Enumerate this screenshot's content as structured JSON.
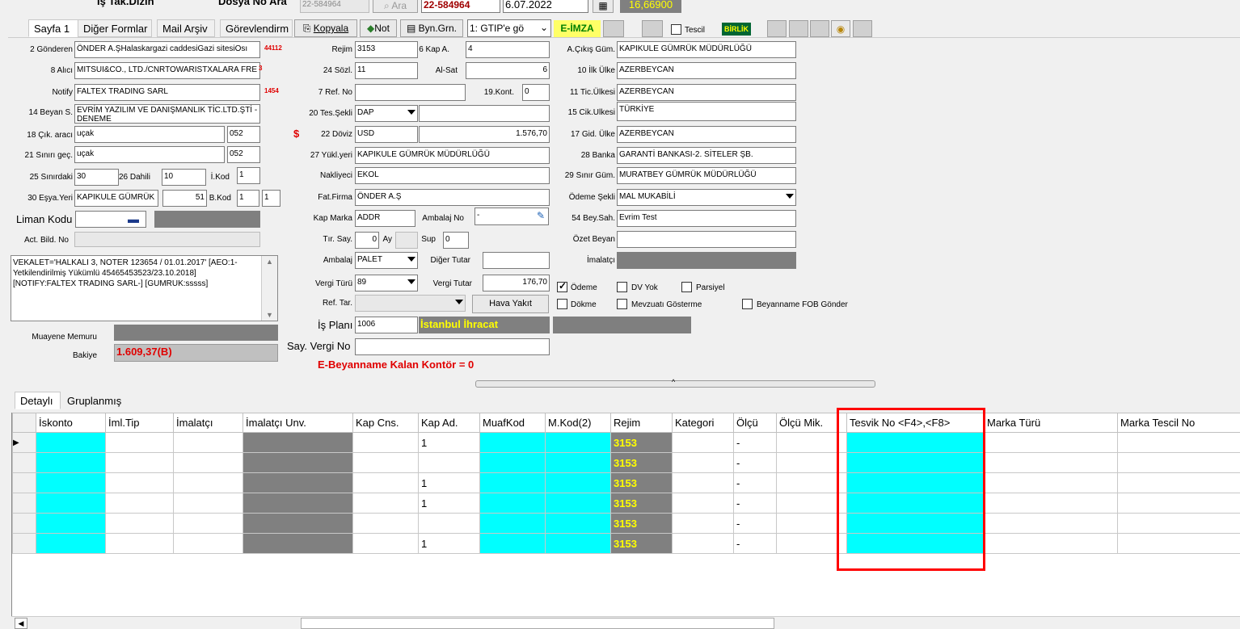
{
  "top": {
    "is_takip": "İş Tak.Dizin",
    "dosya_no_lbl": "Dosya No Ara",
    "dosya_no_val": "22-584964",
    "ara": "Ara",
    "dosya_no_red": "22-584964",
    "date": "6.07.2022",
    "rate": "16,66900"
  },
  "tabs": [
    "Sayfa 1",
    "Diğer Formlar",
    "Mail Arşiv",
    "Görevlendirm"
  ],
  "toolbar": {
    "kopyala": "Kopyala",
    "not": "Not",
    "byn": "Byn.Grn.",
    "gtip": "1: GTIP'e gö",
    "eimza": "E-İMZA",
    "tescil": "Tescil",
    "birlik": "BİRLİK"
  },
  "left": {
    "gonderen_lbl": "2 Gönderen",
    "gonderen": "ÖNDER A.ŞHalaskargazi caddesiGazi sitesiOsı",
    "gonderen_code": "44112",
    "alici_lbl": "8 Alıcı",
    "alici": "MITSUI&CO., LTD./CNRTOWARISTXALARA FRE",
    "alici_code": "3",
    "notify_lbl": "Notify",
    "notify": "FALTEX TRADING SARL",
    "notify_code": "1454",
    "beyan_lbl": "14 Beyan S.",
    "beyan": "EVRİM YAZILIM VE DANIŞMANLIK TİC.LTD.ŞTİ - DENEME",
    "cik_arac_lbl": "18 Çık. aracı",
    "cik_arac": "uçak",
    "cik_arac_code": "052",
    "sinir_lbl": "21 Sınırı geç.",
    "sinir": "uçak",
    "sinir_code": "052",
    "sinirdaki_lbl": "25 Sınırdaki",
    "sinirdaki": "30",
    "dahili_lbl": "26 Dahili",
    "dahili": "10",
    "ikod_lbl": "İ.Kod",
    "ikod": "1",
    "esya_lbl": "30 Eşya.Yeri",
    "esya": "KAPIKULE GÜMRÜK",
    "esya_num": "51",
    "bkod_lbl": "B.Kod",
    "bkod1": "1",
    "bkod2": "1",
    "liman_lbl": "Liman Kodu",
    "act_lbl": "Act. Bild. No",
    "memo": "VEKALET='HALKALI 3, NOTER 123654 / 01.01.2017' [AEO:1-Yetkilendirilmiş Yükümlü 45465453523/23.10.2018] [NOTIFY:FALTEX TRADING SARL-] [GUMRUK:sssss]",
    "muayene_lbl": "Muayene Memuru",
    "bakiye_lbl": "Bakiye",
    "bakiye": "1.609,37(B)"
  },
  "mid": {
    "rejim_lbl": "Rejim",
    "rejim": "3153",
    "kapa_lbl": "6 Kap A.",
    "kapa": "4",
    "sozl_lbl": "24 Sözl.",
    "sozl": "11",
    "alsat_lbl": "Al-Sat",
    "alsat": "6",
    "refno_lbl": "7 Ref. No",
    "refno": "",
    "kont_lbl": "19.Kont.",
    "kont": "0",
    "tes_lbl": "20 Tes.Şekli",
    "tes": "DAP",
    "doviz_lbl": "22 Döviz",
    "doviz": "USD",
    "doviz_amt": "1.576,70",
    "dollar": "$",
    "yuk_lbl": "27 Yükl.yeri",
    "yuk": "KAPIKULE GÜMRÜK MÜDÜRLÜĞÜ",
    "nak_lbl": "Nakliyeci",
    "nak": "EKOL",
    "fat_lbl": "Fat.Firma",
    "fat": "ÖNDER A.Ş",
    "marka_lbl": "Kap Marka",
    "marka": "ADDR",
    "ambno_lbl": "Ambalaj No",
    "ambno": "-",
    "tir_lbl": "Tır. Say.",
    "tir": "0",
    "ay_lbl": "Ay",
    "sup_lbl": "Sup",
    "sup": "0",
    "amb_lbl": "Ambalaj",
    "amb": "PALET",
    "diger_lbl": "Diğer Tutar",
    "diger": "",
    "vturu_lbl": "Vergi Türü",
    "vturu": "89",
    "vtutar_lbl": "Vergi Tutar",
    "vtutar": "176,70",
    "reftar_lbl": "Ref. Tar.",
    "hava": "Hava Yakıt",
    "isplani_lbl": "İş Planı",
    "isplani": "1006",
    "ist": "İstanbul İhracat",
    "sayvergi_lbl": "Say. Vergi No",
    "kontor": "E-Beyanname Kalan Kontör = 0"
  },
  "right": {
    "acikis_lbl": "A.Çıkış Güm.",
    "acikis": "KAPIKULE GÜMRÜK MÜDÜRLÜĞÜ",
    "ilk_lbl": "10 İlk Ülke",
    "ilk": "AZERBEYCAN",
    "tic_lbl": "11 Tic.Ülkesi",
    "tic": "AZERBEYCAN",
    "cik_lbl": "15 Cik.Ulkesi",
    "cik": "TÜRKİYE",
    "gid_lbl": "17 Gid. Ülke",
    "gid": "AZERBEYCAN",
    "banka_lbl": "28 Banka",
    "banka": "GARANTİ BANKASI-2. SİTELER ŞB.",
    "sinirgum_lbl": "29 Sınır Güm.",
    "sinirgum": "MURATBEY GÜMRÜK MÜDÜRLÜĞÜ",
    "odeme_lbl": "Ödeme Şekli",
    "odeme": "MAL MUKABİLİ",
    "beysah_lbl": "54 Bey.Sah.",
    "beysah": "Evrim Test",
    "ozet_lbl": "Özet Beyan",
    "imalatci_lbl": "İmalatçı"
  },
  "checks": {
    "odeme": "Ödeme",
    "dvyok": "DV Yok",
    "parsiyel": "Parsiyel",
    "dokme": "Dökme",
    "mevzuati": "Mevzuatı Gösterme",
    "fob": "Beyanname FOB Gönder"
  },
  "lower_tabs": [
    "Detaylı",
    "Gruplanmış"
  ],
  "columns": [
    "İskonto",
    "İml.Tip",
    "İmalatçı",
    "İmalatçı Unv.",
    "Kap Cns.",
    "Kap Ad.",
    "MuafKod",
    "M.Kod(2)",
    "Rejim",
    "Kategori",
    "Ölçü",
    "Ölçü Mik.",
    "Tesvik No <F4>,<F8>",
    "Marka Türü",
    "Marka Tescil No"
  ],
  "rows": [
    {
      "kapad": "1",
      "rejim": "3153",
      "olcu": "-"
    },
    {
      "kapad": "",
      "rejim": "3153",
      "olcu": "-"
    },
    {
      "kapad": "1",
      "rejim": "3153",
      "olcu": "-"
    },
    {
      "kapad": "1",
      "rejim": "3153",
      "olcu": "-"
    },
    {
      "kapad": "",
      "rejim": "3153",
      "olcu": "-"
    },
    {
      "kapad": "1",
      "rejim": "3153",
      "olcu": "-"
    }
  ]
}
